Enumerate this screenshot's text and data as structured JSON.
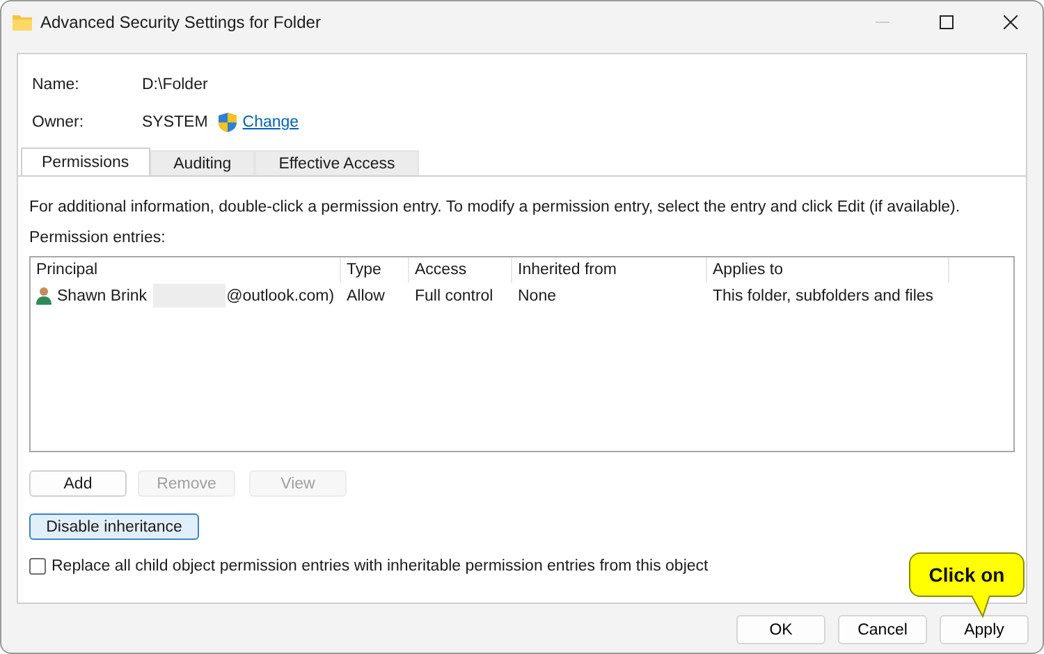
{
  "window": {
    "title": "Advanced Security Settings for Folder"
  },
  "info": {
    "name_label": "Name:",
    "name_value": "D:\\Folder",
    "owner_label": "Owner:",
    "owner_value": "SYSTEM",
    "change_link": "Change"
  },
  "tabs": [
    {
      "label": "Permissions",
      "selected": true
    },
    {
      "label": "Auditing",
      "selected": false
    },
    {
      "label": "Effective Access",
      "selected": false
    }
  ],
  "instructions": "For additional information, double-click a permission entry. To modify a permission entry, select the entry and click Edit (if available).",
  "entries_label": "Permission entries:",
  "table": {
    "columns": [
      "Principal",
      "Type",
      "Access",
      "Inherited from",
      "Applies to"
    ],
    "rows": [
      {
        "principal_name": "Shawn Brink",
        "principal_email": "@outlook.com)",
        "type": "Allow",
        "access": "Full control",
        "inherited_from": "None",
        "applies_to": "This folder, subfolders and files",
        "selected": false
      }
    ]
  },
  "entry_buttons": [
    {
      "label": "Add",
      "disabled": false
    },
    {
      "label": "Remove",
      "disabled": true
    },
    {
      "label": "View",
      "disabled": true
    }
  ],
  "inheritance_button": {
    "label": "Disable inheritance",
    "focused": true
  },
  "replace_checkbox": {
    "label": "Replace all child object permission entries with inheritable permission entries from this object",
    "checked": false
  },
  "footer_buttons": [
    {
      "label": "OK"
    },
    {
      "label": "Cancel"
    },
    {
      "label": "Apply"
    }
  ],
  "callout": {
    "text": "Click on"
  }
}
